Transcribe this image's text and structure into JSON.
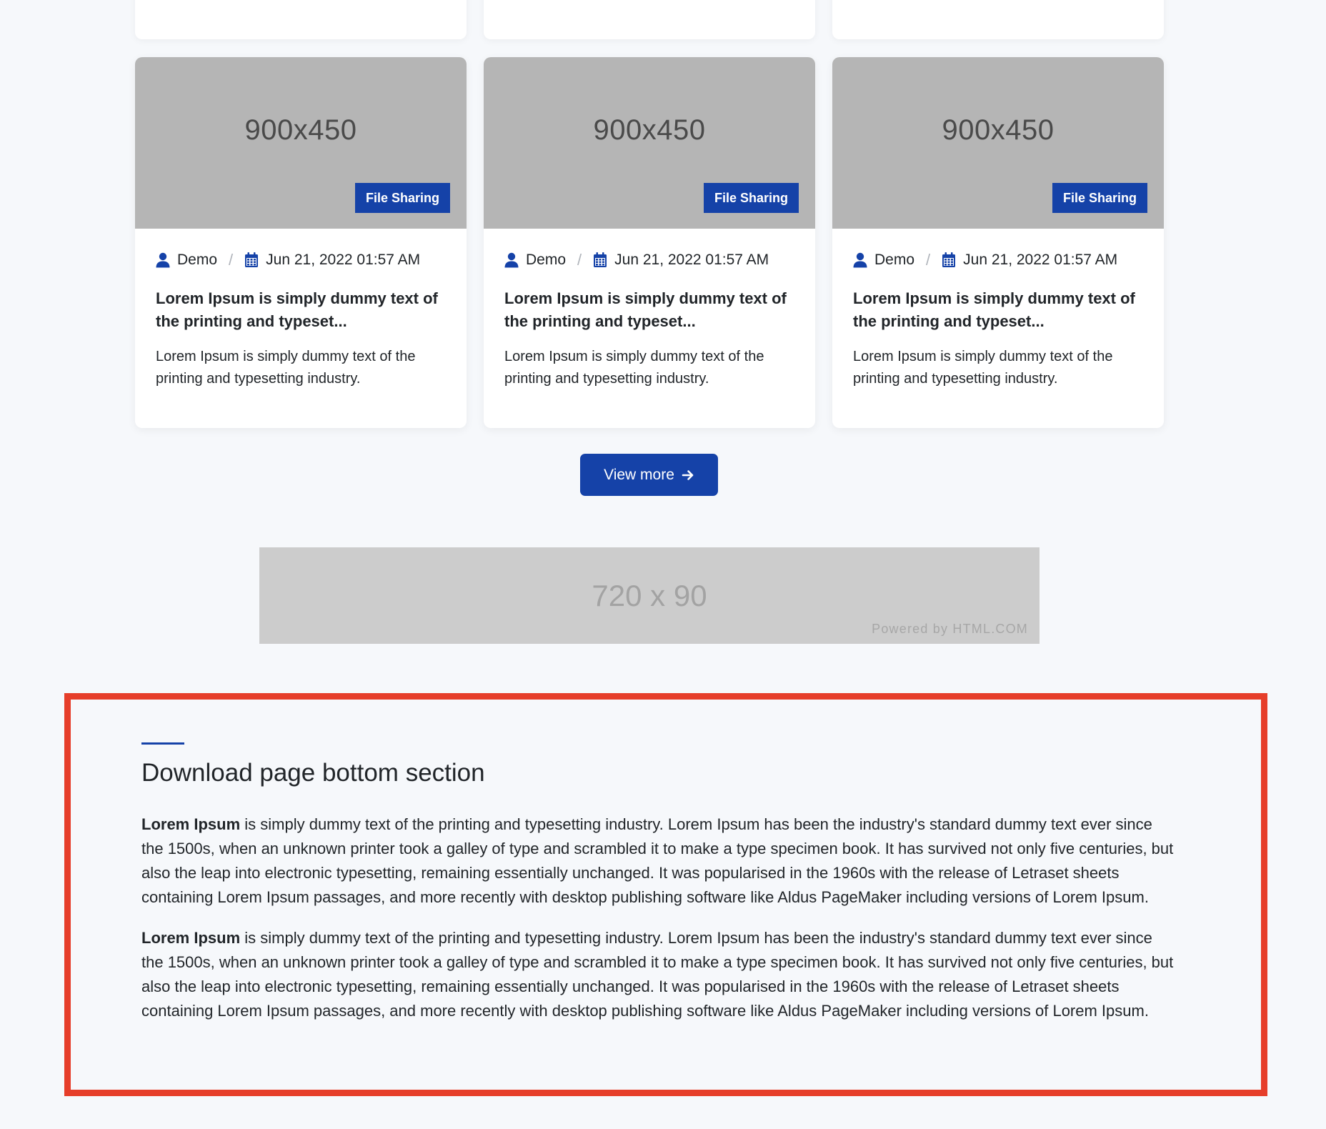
{
  "top_row": {
    "count": 3
  },
  "cards": [
    {
      "image_label": "900x450",
      "category": "File Sharing",
      "author": "Demo",
      "date": "Jun 21, 2022 01:57 AM",
      "title": "Lorem Ipsum is simply dummy text of the printing and typeset...",
      "excerpt": "Lorem Ipsum is simply dummy text of the printing and typesetting industry."
    },
    {
      "image_label": "900x450",
      "category": "File Sharing",
      "author": "Demo",
      "date": "Jun 21, 2022 01:57 AM",
      "title": "Lorem Ipsum is simply dummy text of the printing and typeset...",
      "excerpt": "Lorem Ipsum is simply dummy text of the printing and typesetting industry."
    },
    {
      "image_label": "900x450",
      "category": "File Sharing",
      "author": "Demo",
      "date": "Jun 21, 2022 01:57 AM",
      "title": "Lorem Ipsum is simply dummy text of the printing and typeset...",
      "excerpt": "Lorem Ipsum is simply dummy text of the printing and typesetting industry."
    }
  ],
  "meta_separator": "/",
  "icons": {
    "author": "user-icon",
    "date": "calendar-icon",
    "view_more": "arrow-right-icon"
  },
  "view_more": {
    "label": "View more"
  },
  "ad": {
    "size_label": "720 x 90",
    "powered_by": "Powered by HTML.COM"
  },
  "bottom_section": {
    "title": "Download page bottom section",
    "paragraphs": [
      {
        "lead": "Lorem Ipsum",
        "text": " is simply dummy text of the printing and typesetting industry. Lorem Ipsum has been the industry's standard dummy text ever since the 1500s, when an unknown printer took a galley of type and scrambled it to make a type specimen book. It has survived not only five centuries, but also the leap into electronic typesetting, remaining essentially unchanged. It was popularised in the 1960s with the release of Letraset sheets containing Lorem Ipsum passages, and more recently with desktop publishing software like Aldus PageMaker including versions of Lorem Ipsum."
      },
      {
        "lead": "Lorem Ipsum",
        "text": " is simply dummy text of the printing and typesetting industry. Lorem Ipsum has been the industry's standard dummy text ever since the 1500s, when an unknown printer took a galley of type and scrambled it to make a type specimen book. It has survived not only five centuries, but also the leap into electronic typesetting, remaining essentially unchanged. It was popularised in the 1960s with the release of Letraset sheets containing Lorem Ipsum passages, and more recently with desktop publishing software like Aldus PageMaker including versions of Lorem Ipsum."
      }
    ]
  },
  "colors": {
    "primary": "#1542a8",
    "highlight_border": "#e63e2a",
    "page_background": "#f6f8fb",
    "image_placeholder": "#b5b5b5",
    "ad_background": "#cccccc"
  }
}
